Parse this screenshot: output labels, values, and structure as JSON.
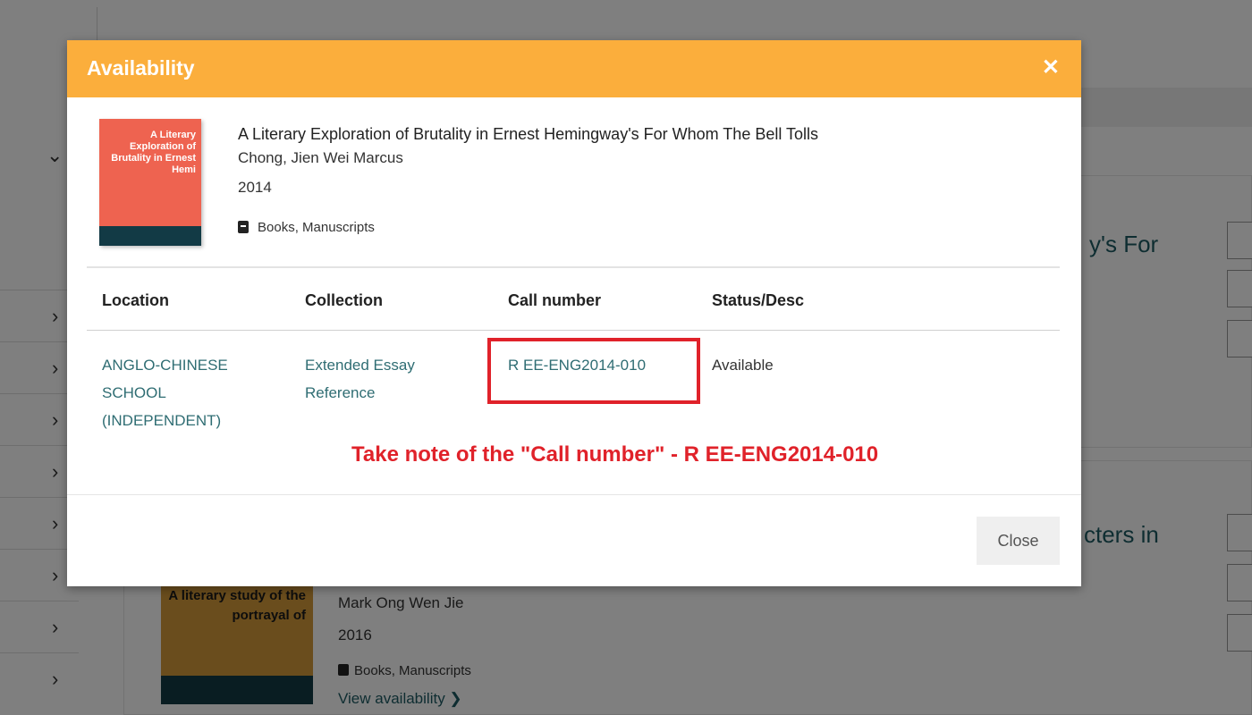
{
  "background": {
    "partial_title_1": "y's For",
    "partial_title_2": "cters in",
    "second_result": {
      "cover_text": "A literary study of the portrayal of",
      "author": "Mark Ong Wen Jie",
      "year": "2016",
      "format": "Books, Manuscripts",
      "link": "View availability ❯"
    },
    "sidebar_icons": [
      "chevron-down-icon",
      "chevron-right-icon"
    ]
  },
  "modal": {
    "title": "Availability",
    "close_glyph": "✕",
    "book": {
      "cover_text": "A Literary Exploration of Brutality in Ernest Hemi",
      "title": "A Literary Exploration of Brutality in Ernest Hemingway's For Whom The Bell Tolls",
      "author": "Chong, Jien Wei Marcus",
      "year": "2014",
      "format": "Books, Manuscripts"
    },
    "table": {
      "headers": [
        "Location",
        "Collection",
        "Call number",
        "Status/Desc"
      ],
      "row": {
        "location_lines": [
          "ANGLO-CHINESE",
          "SCHOOL",
          "(INDEPENDENT)"
        ],
        "collection_lines": [
          "Extended Essay",
          "Reference"
        ],
        "call_number": "R EE-ENG2014-010",
        "status": "Available"
      }
    },
    "annotation": "Take note of the \"Call number\" - R EE-ENG2014-010",
    "close_label": "Close"
  },
  "colors": {
    "header": "#fbae3c",
    "annotation": "#e0222a",
    "link": "#2f6d73",
    "cover": "#ee6350",
    "cover_band": "#123a45"
  }
}
